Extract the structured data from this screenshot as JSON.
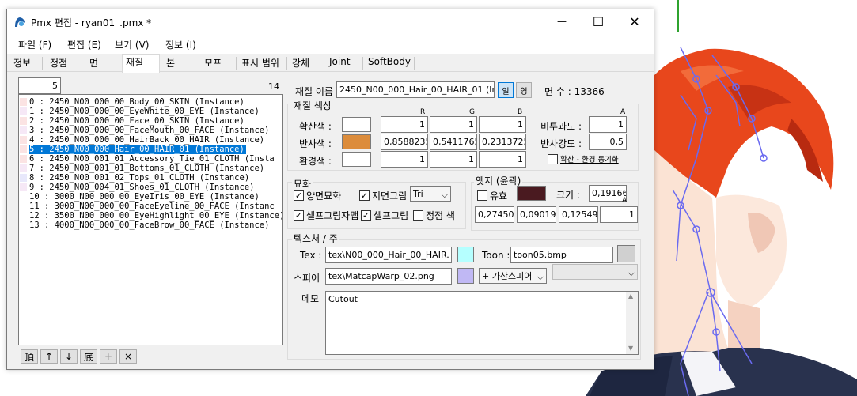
{
  "window": {
    "title": "Pmx 편집 - ryan01_.pmx *",
    "minimize_glyph": "—",
    "maximize_glyph": "☐",
    "close_glyph": "✕"
  },
  "menu": [
    "파일 (F)",
    "편집 (E)",
    "보기 (V)",
    "정보 (I)"
  ],
  "tabs": [
    "정보",
    "정점",
    "면",
    "재질",
    "본",
    "모프",
    "표시 범위",
    "강체",
    "Joint",
    "SoftBody"
  ],
  "active_tab": "재질",
  "list": {
    "index_value": "5",
    "count": "14",
    "items": [
      "0 : 2450_N00_000_00_Body_00_SKIN (Instance)",
      "1 : 2450_N00_000_00_EyeWhite_00_EYE (Instance)",
      "2 : 2450_N00_000_00_Face_00_SKIN (Instance)",
      "3 : 2450_N00_000_00_FaceMouth_00_FACE (Instance)",
      "4 : 2450_N00_000_00_HairBack_00_HAIR (Instance)",
      "5 : 2450_N00_000_Hair_00_HAIR_01 (Instance)",
      "6 : 2450_N00_001_01_Accessory_Tie_01_CLOTH (Insta",
      "7 : 2450_N00_001_01_Bottoms_01_CLOTH (Instance)",
      "8 : 2450_N00_001_02_Tops_01_CLOTH (Instance)",
      "9 : 2450_N00_004_01_Shoes_01_CLOTH (Instance)",
      "10 : 3000_N00_000_00_EyeIris_00_EYE (Instance)",
      "11 : 3000_N00_000_00_FaceEyeline_00_FACE (Instanc",
      "12 : 3500_N00_000_00_EyeHighlight_00_EYE (Instance)",
      "13 : 4000_N00_000_00_FaceBrow_00_FACE (Instance)"
    ],
    "selected_index": 5,
    "buttons": [
      "頂",
      "↑",
      "↓",
      "底",
      "+",
      "×"
    ]
  },
  "material": {
    "name_label": "재질 이름",
    "name_value": "2450_N00_000_Hair_00_HAIR_01 (Ins",
    "lang_buttons": [
      "일",
      "영"
    ],
    "face_count_label": "면 수 : 13366"
  },
  "color_section": {
    "title": "재질 색상",
    "headers": [
      "R",
      "G",
      "B",
      "A"
    ],
    "diffuse_label": "확산색 :",
    "diffuse_swatch": "#ffffff",
    "diffuse": [
      "1",
      "1",
      "1"
    ],
    "specular_label": "반사색 :",
    "specular_swatch": "#dc8c3b",
    "specular": [
      "0,8588235",
      "0,5411765",
      "0,2313725"
    ],
    "ambient_label": "환경색 :",
    "ambient_swatch": "#ffffff",
    "ambient": [
      "1",
      "1",
      "1"
    ],
    "alpha_label": "비투과도 :",
    "alpha_value": "1",
    "spec_power_label": "반사강도 :",
    "spec_power_value": "0,5",
    "sync_label": "확산 - 환경 동기화"
  },
  "render_section": {
    "title": "묘화",
    "double_sided": "양면묘화",
    "ground_shadow": "지면그림",
    "shadow_mode": "Tri",
    "self_shadow_map": "셀프그림자맵",
    "self_shadow": "셀프그림",
    "vertex_color": "정점 색"
  },
  "edge_section": {
    "title": "엣지 (윤곽)",
    "enabled_label": "유효",
    "edge_swatch": "#4a1a20",
    "size_label": "크기 :",
    "size_value": "0,191666",
    "alpha_header": "A",
    "rgb": [
      "0,274509",
      "0,090196",
      "0,125490"
    ],
    "alpha_value": "1"
  },
  "texture_section": {
    "title": "텍스처 / 주",
    "tex_label": "Tex :",
    "tex_value": "tex\\N00_000_Hair_00_HAIR.",
    "tex_swatch": "#b5ffff",
    "toon_label": "Toon :",
    "toon_value": "toon05.bmp",
    "toon_swatch": "#d0d0d0",
    "sphere_label": "스피어",
    "sphere_value": "tex\\MatcapWarp_02.png",
    "sphere_swatch": "#c0b8f4",
    "sphere_mode": "+ 가산스피어",
    "memo_label": "메모",
    "memo_value": "Cutout"
  }
}
